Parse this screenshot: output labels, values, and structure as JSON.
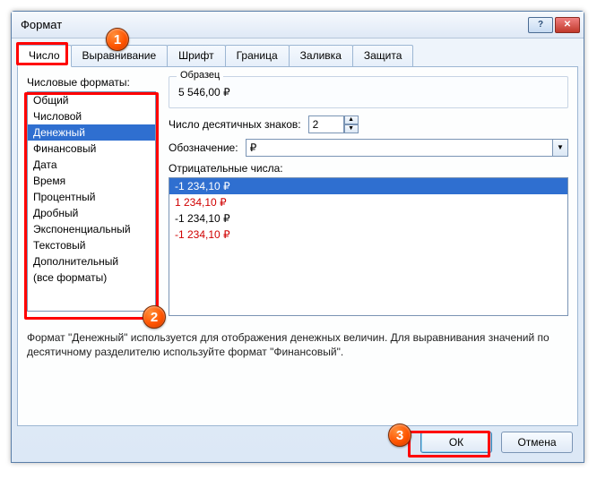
{
  "window": {
    "title": "Формат "
  },
  "tabs": [
    {
      "label": "Число",
      "active": true
    },
    {
      "label": "Выравнивание"
    },
    {
      "label": "Шрифт"
    },
    {
      "label": "Граница"
    },
    {
      "label": "Заливка"
    },
    {
      "label": "Защита"
    }
  ],
  "left": {
    "label": "Числовые форматы:",
    "items": [
      "Общий",
      "Числовой",
      "Денежный",
      "Финансовый",
      "Дата",
      "Время",
      "Процентный",
      "Дробный",
      "Экспоненциальный",
      "Текстовый",
      "Дополнительный",
      "(все форматы)"
    ],
    "selected_index": 2
  },
  "sample": {
    "title": "Образец",
    "value": "5 546,00 ₽"
  },
  "decimals": {
    "label": "Число десятичных знаков:",
    "value": "2"
  },
  "symbol": {
    "label": "Обозначение:",
    "value": "₽"
  },
  "negative": {
    "label": "Отрицательные числа:",
    "items": [
      {
        "text": "-1 234,10 ₽",
        "color": "#ffffff",
        "selected": true
      },
      {
        "text": "1 234,10 ₽",
        "color": "#d00000"
      },
      {
        "text": "-1 234,10 ₽",
        "color": "#000000"
      },
      {
        "text": "-1 234,10 ₽",
        "color": "#d00000"
      }
    ]
  },
  "description": "Формат \"Денежный\" используется для отображения денежных величин. Для выравнивания значений по десятичному разделителю используйте формат \"Финансовый\".",
  "buttons": {
    "ok": "ОК",
    "cancel": "Отмена"
  },
  "markers": [
    "1",
    "2",
    "3"
  ]
}
